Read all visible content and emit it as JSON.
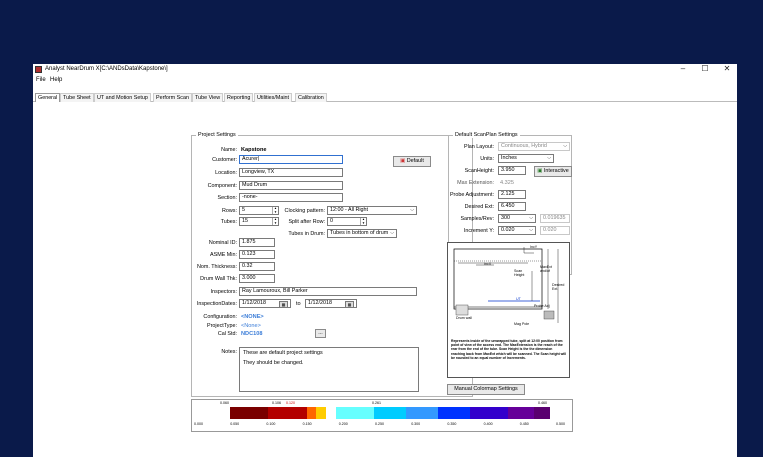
{
  "window": {
    "title": "Analyst NearDrum X[C:\\ANDsData\\Kapstone\\]",
    "controls": [
      "–",
      "☐",
      "✕"
    ]
  },
  "menu": [
    "File",
    "Help"
  ],
  "tabs": [
    "General",
    "Tube Sheet",
    "UT and Motion Setup",
    "Perform Scan",
    "Tube View",
    "Reporting",
    "Utilities/Maint",
    "Calibration"
  ],
  "project": {
    "group_label": "Project Settings",
    "name_label": "Name:",
    "name": "Kapstone",
    "customer_label": "Customer:",
    "customer": "Acurer|",
    "location_label": "Location:",
    "location": "Longview, TX",
    "component_label": "Component:",
    "component": "Mud Drum",
    "section_label": "Section:",
    "section": "-none-",
    "default_button": "Default",
    "rows_label": "Rows:",
    "rows": "5",
    "tubes_label": "Tubes:",
    "tubes": "15",
    "clocking_label": "Clocking pattern:",
    "clocking": "12:00 - All Right",
    "split_label": "Split after Row:",
    "split": "0",
    "tubes_in_drum_label": "Tubes in Drum:",
    "tubes_in_drum": "Tubes in bottom of drum",
    "nominal_id_label": "Nominal ID:",
    "nominal_id": "1.875",
    "asme_min_label": "ASME Min:",
    "asme_min": "0.123",
    "nom_thk_label": "Nom. Thickness:",
    "nom_thk": "0.32",
    "drum_wall_label": "Drum Wall Thk:",
    "drum_wall": "3.000",
    "inspectors_label": "Inspectors:",
    "inspectors": "Ray Lamouroux, Bill Parker",
    "insp_dates_label": "InspectionDates:",
    "date_from": "1/12/2018",
    "date_to_label": "to",
    "date_to": "1/12/2018",
    "config_label": "Configuration:",
    "config": "<NONE>",
    "project_type_label": "ProjectType:",
    "project_type": "<None>",
    "cal_std_label": "Cal Std:",
    "cal_std": "NDC108",
    "browse_button": "...",
    "notes_label": "Notes:",
    "notes_line1": "These are default project settings",
    "notes_line2": "They should be changed."
  },
  "scanplan": {
    "group_label": "Default ScanPlan Settings",
    "plan_layout_label": "Plan Layout:",
    "plan_layout": "Continuous, Hybrid",
    "units_label": "Units:",
    "units": "Inches",
    "scan_height_label": "ScanHeight:",
    "scan_height": "3.950",
    "interactive_button": "Interactive",
    "max_ext_label": "Max Extension:",
    "max_ext": "4.325",
    "probe_adj_label": "Probe Adjustment:",
    "probe_adj": "2.125",
    "desired_ext_label": "Desired Ext:",
    "desired_ext": "6.450",
    "samples_label": "Samples/Rev:",
    "samples": "300",
    "samples_res": "0.019635",
    "increment_label": "Increment Y:",
    "increment": "0.020",
    "increment_res": "0.020",
    "manual_colormap_button": "Manual Colormap Settings"
  },
  "diagram": {
    "labels": {
      "incy": "IncY",
      "incx": "IncX",
      "scan_height": "Scan\nHeight",
      "maxext": "MaxExt\nand/of",
      "desired_ext": "Desired\nExt.",
      "ut": "UT",
      "probe_adj": "Probe Adj",
      "drum_wall": "Drum wall",
      "mag_pole": "Mag Pole"
    },
    "caption": "Represents inside of the unwrapped tube, split at 12:00 position from point of view of the access end. The MaxExtension is the reach of the rear from the end of the tube. Scan Height is the the dimension reaching back from MaxExt which will be scanned. The Scan height will be rounded to an equal number of Increments."
  },
  "colormap": {
    "top_ticks": [
      "0.060",
      "0.106",
      "0.120",
      "0.261",
      "0.460"
    ],
    "bottom_ticks": [
      "0.000",
      "0.050",
      "0.100",
      "0.150",
      "0.200",
      "0.250",
      "0.300",
      "0.350",
      "0.400",
      "0.450",
      "0.500"
    ],
    "colors": [
      "#7a0000",
      "#b30000",
      "#ff6600",
      "#ffcc00",
      "#ffffff",
      "#66ffff",
      "#00ccff",
      "#3399ff",
      "#0033ff",
      "#3300cc",
      "#660099",
      "#5a0070"
    ]
  }
}
